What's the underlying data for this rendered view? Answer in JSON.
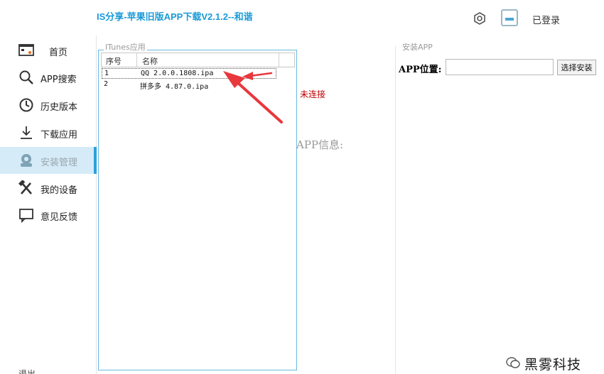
{
  "window": {
    "title": "IS分享-苹果旧版APP下载V2.1.2--和谐",
    "login_status": "已登录"
  },
  "sidebar": {
    "items": [
      {
        "label": "首页",
        "icon": "home-screen-icon"
      },
      {
        "label": "APP搜索",
        "icon": "search-icon"
      },
      {
        "label": "历史版本",
        "icon": "clock-icon"
      },
      {
        "label": "下载应用",
        "icon": "download-icon"
      },
      {
        "label": "安装管理",
        "icon": "install-manage-icon",
        "active": true
      },
      {
        "label": "我的设备",
        "icon": "tools-icon"
      },
      {
        "label": "意见反馈",
        "icon": "feedback-icon"
      }
    ],
    "bottom_label": "退出"
  },
  "itunes_panel": {
    "group_label": "ITunes应用",
    "columns": [
      "序号",
      "名称"
    ],
    "rows": [
      {
        "index": "1",
        "name": "QQ 2.0.0.1808.ipa",
        "selected": true
      },
      {
        "index": "2",
        "name": "拼多多 4.87.0.ipa",
        "selected": false
      }
    ]
  },
  "device": {
    "connection_status": "未连接",
    "app_info_label": "APP信息:"
  },
  "install_panel": {
    "group_label": "安装APP",
    "location_label": "APP位置:",
    "location_value": "",
    "choose_button": "选择安装"
  },
  "watermark": {
    "text": "黑雾科技",
    "icon": "wechat-icon"
  },
  "colors": {
    "accent": "#2ba0db",
    "title": "#1a9ad6",
    "active_bg": "#d5ebf8",
    "status_red": "#c00000",
    "arrow_red": "#e8383d"
  }
}
